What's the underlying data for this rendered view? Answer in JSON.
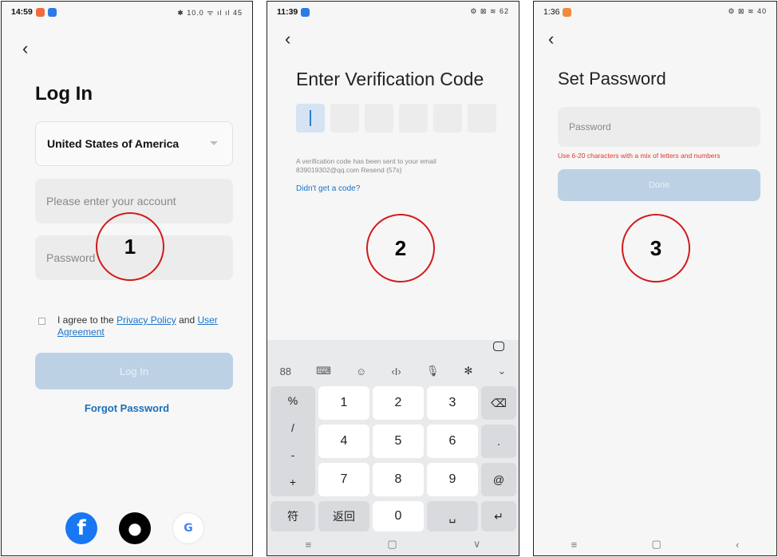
{
  "screen1": {
    "status_time": "14:59",
    "status_right": "✱ 10.0 ᯤ ıl ıl 45",
    "title": "Log In",
    "country": "United States of America",
    "account_placeholder": "Please enter your account",
    "password_placeholder": "Password",
    "agree_prefix": "I agree to the",
    "privacy_link": "Privacy Policy",
    "and_text": "and",
    "user_agreement_link": "User Agreement",
    "login_button": "Log In",
    "forgot_link": "Forgot Password",
    "badge": "1",
    "social": [
      "facebook-icon",
      "apple-icon",
      "google-icon"
    ],
    "google_glyph": "G"
  },
  "screen2": {
    "status_time": "11:39",
    "status_right": "⚙ ⊠ ≋ 62",
    "title": "Enter Verification Code",
    "info_line1": "A verification code has been sent to your email",
    "info_line2": "839019302@qq.com Resend (57s)",
    "resend_link": "Didn't get a code?",
    "badge": "2",
    "toolbar": [
      "88",
      "⌨",
      "☺",
      "‹I›",
      "🎙",
      "✻",
      "⌄"
    ],
    "symbols": [
      "%",
      "/",
      "-",
      "+"
    ],
    "keys": {
      "k1": "1",
      "k2": "2",
      "k3": "3",
      "k4": "4",
      "k5": "5",
      "k6": "6",
      "k7": "7",
      "k8": "8",
      "k9": "9",
      "k0": "0",
      "backspace": "⌫",
      "dot": ".",
      "at": "@",
      "fu": "符",
      "fanhui": "返回",
      "space": "␣",
      "enter": "↵"
    },
    "nav": [
      "≡",
      "▢",
      "∨"
    ]
  },
  "screen3": {
    "status_time": "1:36",
    "status_right": "⚙ ⊠ ≋ 40",
    "title": "Set Password",
    "password_placeholder": "Password",
    "hint": "Use 6-20 characters with a mix of letters and numbers",
    "done_button": "Done",
    "badge": "3",
    "nav": [
      "≡",
      "▢",
      "‹"
    ]
  },
  "colors": {
    "accent": "#1a73c8",
    "disabled_button": "#bcd2e4",
    "badge_ring": "#d21a1a",
    "error": "#e0382e"
  }
}
